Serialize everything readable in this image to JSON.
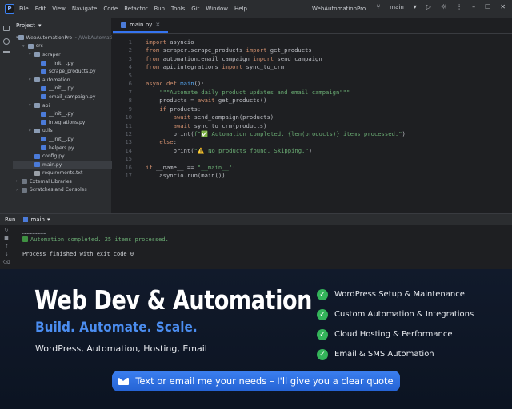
{
  "titlebar": {
    "menu": [
      "File",
      "Edit",
      "View",
      "Navigate",
      "Code",
      "Refactor",
      "Run",
      "Tools",
      "Git",
      "Window",
      "Help"
    ],
    "window_title": "WebAutomationPro",
    "branch": "main"
  },
  "project": {
    "header": "Project",
    "tree": [
      {
        "label": "WebAutomationPro",
        "extra": "~/WebAutomationPro",
        "indent": 0,
        "arrow": "▾",
        "icon": "folder"
      },
      {
        "label": "src",
        "extra": "",
        "indent": 1,
        "arrow": "▾",
        "icon": "folder"
      },
      {
        "label": "scraper",
        "extra": "",
        "indent": 2,
        "arrow": "▾",
        "icon": "folder"
      },
      {
        "label": "__init__.py",
        "extra": "",
        "indent": 3,
        "arrow": "",
        "icon": "py"
      },
      {
        "label": "scrape_products.py",
        "extra": "",
        "indent": 3,
        "arrow": "",
        "icon": "py"
      },
      {
        "label": "automation",
        "extra": "",
        "indent": 2,
        "arrow": "▾",
        "icon": "folder"
      },
      {
        "label": "__init__.py",
        "extra": "",
        "indent": 3,
        "arrow": "",
        "icon": "py"
      },
      {
        "label": "email_campaign.py",
        "extra": "",
        "indent": 3,
        "arrow": "",
        "icon": "py"
      },
      {
        "label": "api",
        "extra": "",
        "indent": 2,
        "arrow": "▾",
        "icon": "folder"
      },
      {
        "label": "__init__.py",
        "extra": "",
        "indent": 3,
        "arrow": "",
        "icon": "py"
      },
      {
        "label": "integrations.py",
        "extra": "",
        "indent": 3,
        "arrow": "",
        "icon": "py"
      },
      {
        "label": "utils",
        "extra": "",
        "indent": 2,
        "arrow": "▾",
        "icon": "folder"
      },
      {
        "label": "__init__.py",
        "extra": "",
        "indent": 3,
        "arrow": "",
        "icon": "py"
      },
      {
        "label": "helpers.py",
        "extra": "",
        "indent": 3,
        "arrow": "",
        "icon": "py"
      },
      {
        "label": "config.py",
        "extra": "",
        "indent": 2,
        "arrow": "",
        "icon": "py"
      },
      {
        "label": "main.py",
        "extra": "",
        "indent": 2,
        "arrow": "",
        "icon": "py",
        "selected": true
      },
      {
        "label": "requirements.txt",
        "extra": "",
        "indent": 2,
        "arrow": "",
        "icon": "txt"
      },
      {
        "label": "External Libraries",
        "extra": "",
        "indent": 0,
        "arrow": "›",
        "icon": "lib"
      },
      {
        "label": "Scratches and Consoles",
        "extra": "",
        "indent": 0,
        "arrow": "›",
        "icon": "lib"
      }
    ]
  },
  "editor": {
    "tab": "main.py",
    "lines": [
      {
        "n": "1",
        "html": "<span class='kw'>import</span> asyncio"
      },
      {
        "n": "2",
        "html": "<span class='kw'>from</span> scraper.scrape_products <span class='kw'>import</span> get_products"
      },
      {
        "n": "3",
        "html": "<span class='kw'>from</span> automation.email_campaign <span class='kw'>import</span> send_campaign"
      },
      {
        "n": "4",
        "html": "<span class='kw'>from</span> api.integrations <span class='kw'>import</span> sync_to_crm"
      },
      {
        "n": "5",
        "html": ""
      },
      {
        "n": "6",
        "html": "<span class='kw'>async def</span> <span class='fn'>main</span>():"
      },
      {
        "n": "7",
        "html": "    <span class='str'>\"\"\"Automate daily product updates and email campaign\"\"\"</span>"
      },
      {
        "n": "8",
        "html": "    products = <span class='kw'>await</span> get_products()"
      },
      {
        "n": "9",
        "html": "    <span class='kw'>if</span> products:"
      },
      {
        "n": "10",
        "html": "        <span class='kw'>await</span> send_campaign(products)"
      },
      {
        "n": "11",
        "html": "        <span class='kw'>await</span> sync_to_crm(products)"
      },
      {
        "n": "12",
        "html": "        print(<span class='str'>f\"✅ Automation completed. {len(products)} items processed.\"</span>)"
      },
      {
        "n": "13",
        "html": "    <span class='kw'>else</span>:"
      },
      {
        "n": "14",
        "html": "        print(<span class='str'>\"⚠️ No products found. Skipping.\"</span>)"
      },
      {
        "n": "15",
        "html": ""
      },
      {
        "n": "16",
        "html": "<span class='kw'>if</span> __name__ == <span class='str'>\"__main__\"</span>:"
      },
      {
        "n": "17",
        "html": "    asyncio.run(main())"
      }
    ]
  },
  "run": {
    "tab_label": "Run",
    "config": "main",
    "output_ok": "Automation completed. 25 items processed.",
    "output_exit": "Process finished with exit code 0"
  },
  "promo": {
    "headline": "Web Dev & Automation",
    "subhead": "Build. Automate. Scale.",
    "services": "WordPress, Automation, Hosting, Email",
    "features": [
      "WordPress Setup & Maintenance",
      "Custom Automation & Integrations",
      "Cloud Hosting & Performance",
      "Email & SMS Automation"
    ],
    "cta": "Text or email me your needs – I'll give you a clear quote"
  },
  "colors": {
    "accent": "#3b7ff0",
    "check": "#34b35a",
    "keyword": "#cf8e6d",
    "string": "#6aab73"
  }
}
